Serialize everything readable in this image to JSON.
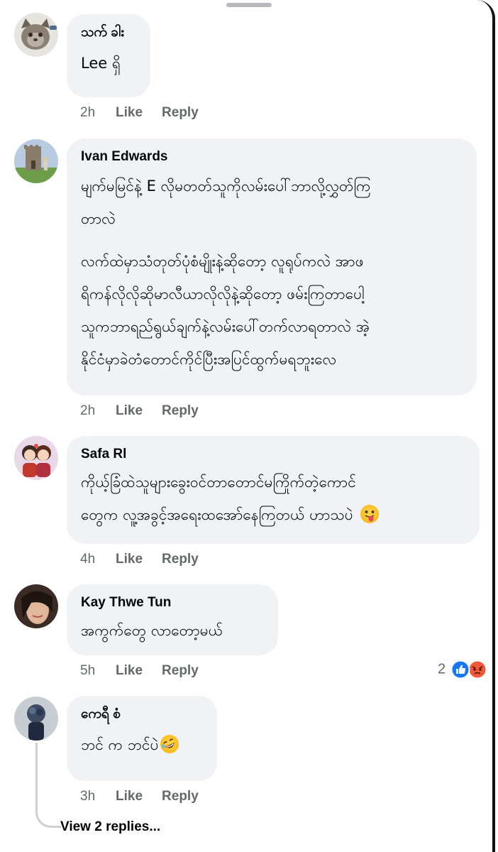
{
  "comments": [
    {
      "author": "သက် ခါး",
      "lines": [
        "Lee ရှိ"
      ],
      "time": "2h",
      "like_label": "Like",
      "reply_label": "Reply"
    },
    {
      "author": "Ivan Edwards",
      "lines": [
        "မျက်မမြင်နဲ့ E လိုမတတ်သူကိုလမ်းပေါ်ဘာလို့လွှတ်ကြ",
        "တာလဲ",
        "လက်ထဲမှာသံတုတ်ပုံစံမျိုးနဲ့ဆိုတော့ လူရုပ်ကလဲ အာဖ",
        "ရိကန်လိုလိုဆိုမာလီယာလိုလိုနဲ့ဆိုတော့ ဖမ်းကြတာပေါ့",
        "သူကဘာရည်ရွယ်ချက်နဲ့လမ်းပေါ်တက်လာရတာလဲ  အဲ့",
        "နိုင်ငံမှာခဲတံတောင်ကိုင်ပြီးအပြင်ထွက်မရဘူးလေ"
      ],
      "time": "2h",
      "like_label": "Like",
      "reply_label": "Reply"
    },
    {
      "author": "Safa Rl",
      "lines": [
        "ကိုယ့်ခြံထဲသူများခွေးဝင်တာတောင်မကြိုက်တဲ့ကောင်",
        "တွေက လူ့အခွင့်အရေးထအော်နေကြတယ် ဟာသပဲ"
      ],
      "line2_emoji": "tongue-out-emoji",
      "time": "4h",
      "like_label": "Like",
      "reply_label": "Reply"
    },
    {
      "author": "Kay Thwe Tun",
      "lines": [
        "အကွက်တွေ လာတော့မယ်"
      ],
      "time": "5h",
      "like_label": "Like",
      "reply_label": "Reply",
      "reaction_count": "2",
      "reaction_icons": [
        "like-reaction-icon",
        "angry-reaction-icon"
      ]
    },
    {
      "author": "ကေရီ စံ",
      "lines": [
        "ဘင် က ဘင်ပဲ"
      ],
      "line1_emoji": "rolling-laughing-emoji",
      "time": "3h",
      "like_label": "Like",
      "reply_label": "Reply"
    }
  ],
  "view_replies_label": "View 2 replies...",
  "colors": {
    "bubble": "#f0f2f5",
    "meta_text": "#65676b",
    "like_blue": "#1877f2",
    "angry": "#f05a3a"
  }
}
